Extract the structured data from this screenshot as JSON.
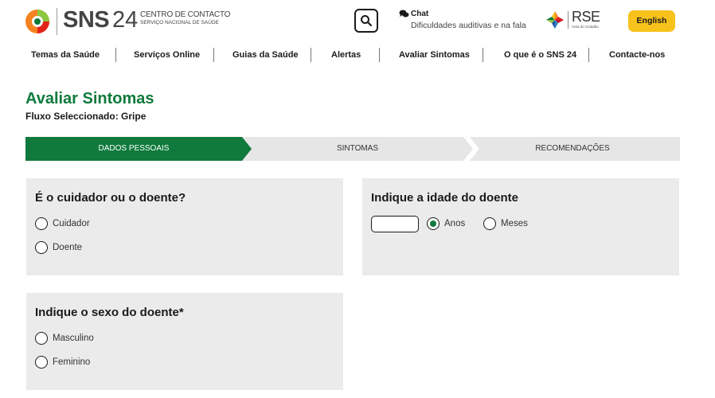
{
  "header": {
    "logo_sns": "SNS",
    "logo_24": "24",
    "logo_line1": "CENTRO DE CONTACTO",
    "logo_line2": "SERVIÇO NACIONAL DE SAÚDE",
    "chat_label": "Chat",
    "chat_sub": "Dificuldades auditivas e na fala",
    "rse_text": "RSE",
    "rse_sub": "Área do Cidadão",
    "english_label": "English",
    "icons": [
      "sns24-logo-icon",
      "search-icon",
      "chat-icon",
      "rse-logo-icon"
    ]
  },
  "nav": {
    "items": [
      "Temas da Saúde",
      "Serviços Online",
      "Guias da Saúde",
      "Alertas",
      "Avaliar Sintomas",
      "O que é o SNS 24",
      "Contacte-nos"
    ]
  },
  "page": {
    "title": "Avaliar Sintomas",
    "subtitle": "Fluxo Seleccionado: Gripe"
  },
  "stepper": {
    "steps": [
      "DADOS PESSOAIS",
      "SINTOMAS",
      "RECOMENDAÇÕES"
    ],
    "active_index": 0
  },
  "cards": {
    "caregiver": {
      "title": "É o cuidador ou o doente?",
      "options": [
        "Cuidador",
        "Doente"
      ],
      "selected": null
    },
    "age": {
      "title": "Indique a idade do doente",
      "value": "",
      "units": [
        "Anos",
        "Meses"
      ],
      "selected_unit": "Anos"
    },
    "sex": {
      "title": "Indique o sexo do doente*",
      "options": [
        "Masculino",
        "Feminino"
      ],
      "selected": null
    }
  },
  "colors": {
    "primary_green": "#0f7a3c",
    "english_yellow": "#f7c21b",
    "card_grey": "#ebebeb",
    "step_grey": "#e6e6e6"
  }
}
